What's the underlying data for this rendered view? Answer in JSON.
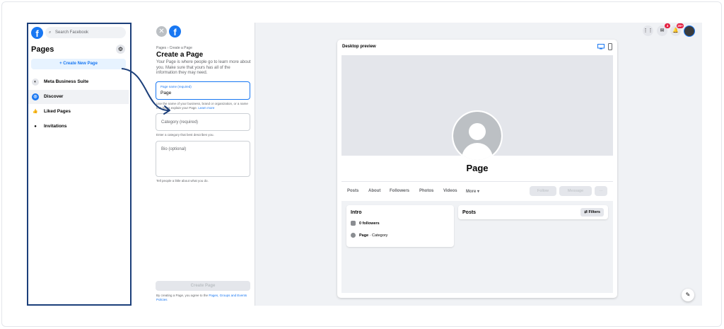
{
  "sidebar": {
    "search_placeholder": "Search Facebook",
    "title": "Pages",
    "create_button": "+ Create New Page",
    "items": [
      {
        "label": "Meta Business Suite",
        "icon": "meta-icon"
      },
      {
        "label": "Discover",
        "icon": "discover-icon",
        "active": true
      },
      {
        "label": "Liked Pages",
        "icon": "thumbs-up-icon"
      },
      {
        "label": "Invitations",
        "icon": "person-icon"
      }
    ]
  },
  "create_panel": {
    "breadcrumb": "Pages › Create a Page",
    "title": "Create a Page",
    "description": "Your Page is where people go to learn more about you. Make sure that yours has all of the information they may need.",
    "page_name_label": "Page name (required)",
    "page_name_value": "Page",
    "page_name_hint": "Use the name of your business, brand or organization, or a name that helps explain your Page.",
    "learn_more": "Learn more",
    "category_placeholder": "Category (required)",
    "category_hint": "Enter a category that best describes you.",
    "bio_placeholder": "Bio (optional)",
    "bio_hint": "Tell people a little about what you do.",
    "create_button": "Create Page",
    "terms_prefix": "By creating a Page, you agree to the",
    "terms_link": "Pages, Groups and Events Policies"
  },
  "top_nav": {
    "messenger_badge": "3",
    "notifications_badge": "20+"
  },
  "preview": {
    "label": "Desktop preview",
    "page_name": "Page",
    "tabs": [
      "Posts",
      "About",
      "Followers",
      "Photos",
      "Videos",
      "More ▾"
    ],
    "follow_button": "Follow",
    "message_button": "Message",
    "more_button": "···",
    "intro_title": "Intro",
    "followers": "0 followers",
    "page_category_bold": "Page",
    "page_category_rest": " · Category",
    "posts_title": "Posts",
    "filters_button": "Filters"
  },
  "colors": {
    "accent": "#1877f2",
    "highlight_border": "#1c3f7a",
    "badge": "#e41e3f"
  }
}
